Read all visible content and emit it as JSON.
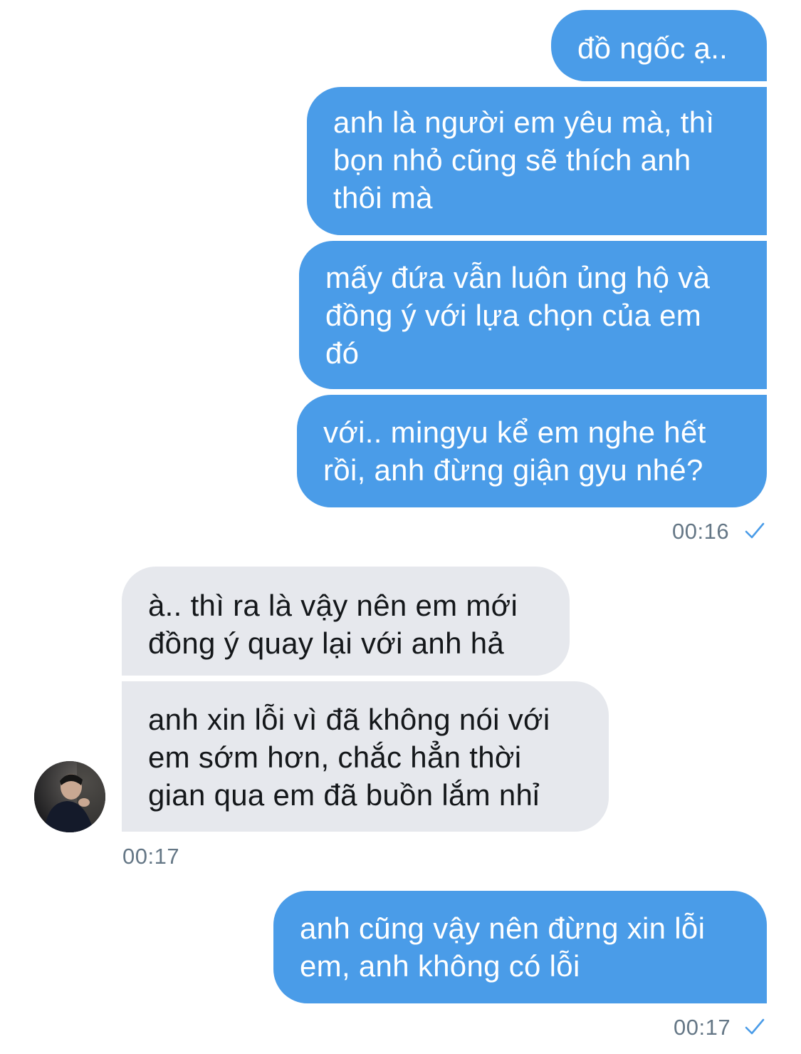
{
  "colors": {
    "sent_bubble": "#4a9ce8",
    "received_bubble": "#e6e8ed",
    "sent_text": "#ffffff",
    "received_text": "#14171a",
    "timestamp": "#657786",
    "read_check": "#4a9ce8"
  },
  "messages": [
    {
      "id": "m1",
      "direction": "sent",
      "text": "đồ ngốc ạ.."
    },
    {
      "id": "m2",
      "direction": "sent",
      "text": "anh là người em yêu mà, thì\nbọn nhỏ cũng sẽ thích anh\nthôi mà"
    },
    {
      "id": "m3",
      "direction": "sent",
      "text": "mấy đứa vẫn luôn ủng hộ và\nđồng ý với lựa chọn của em\nđó"
    },
    {
      "id": "m4",
      "direction": "sent",
      "text": "với.. mingyu kể em nghe hết\nrồi, anh đừng giận gyu nhé?"
    },
    {
      "id": "m5",
      "direction": "received",
      "text": "à.. thì ra là vậy nên em mới\nđồng ý quay lại với anh hả"
    },
    {
      "id": "m6",
      "direction": "received",
      "text": "anh xin lỗi vì đã không nói với\nem sớm hơn, chắc hẳn thời\ngian qua em đã buồn lắm nhỉ"
    },
    {
      "id": "m7",
      "direction": "sent",
      "text": "anh cũng vậy nên đừng xin lỗi\nem, anh không có lỗi"
    }
  ],
  "timestamps": {
    "group1": "00:16",
    "group2": "00:17",
    "group3": "00:17"
  },
  "icons": {
    "read_receipt": "check-icon",
    "avatar": "contact-avatar"
  }
}
